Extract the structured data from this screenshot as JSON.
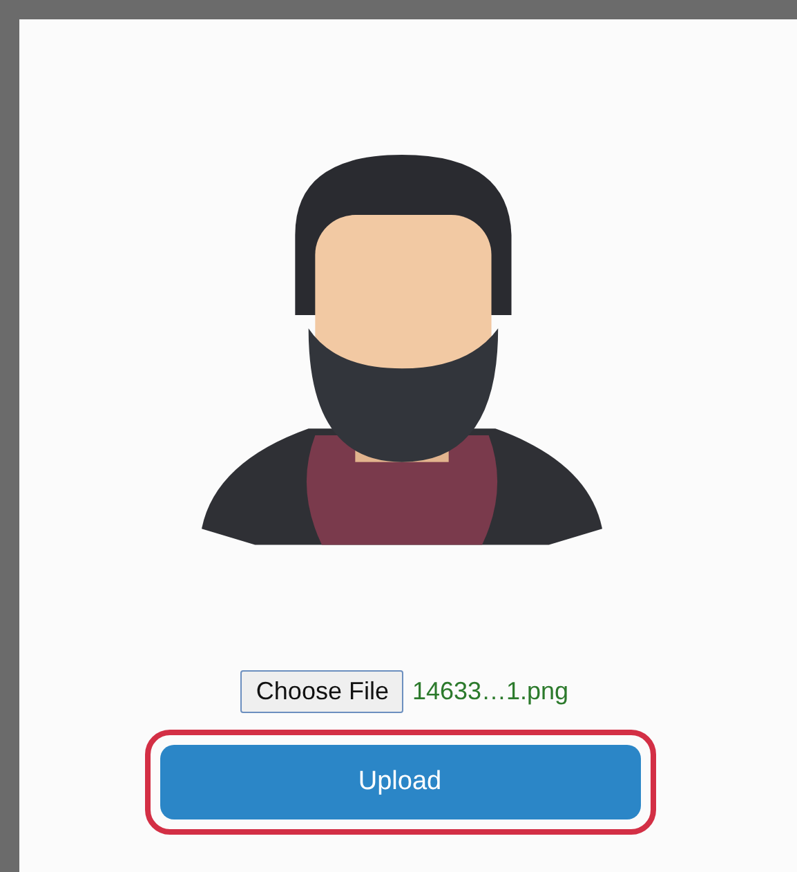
{
  "file_input": {
    "button": "Choose File",
    "filename": "14633…1.png"
  },
  "upload_button": {
    "label": "Upload",
    "highlighted": true
  }
}
